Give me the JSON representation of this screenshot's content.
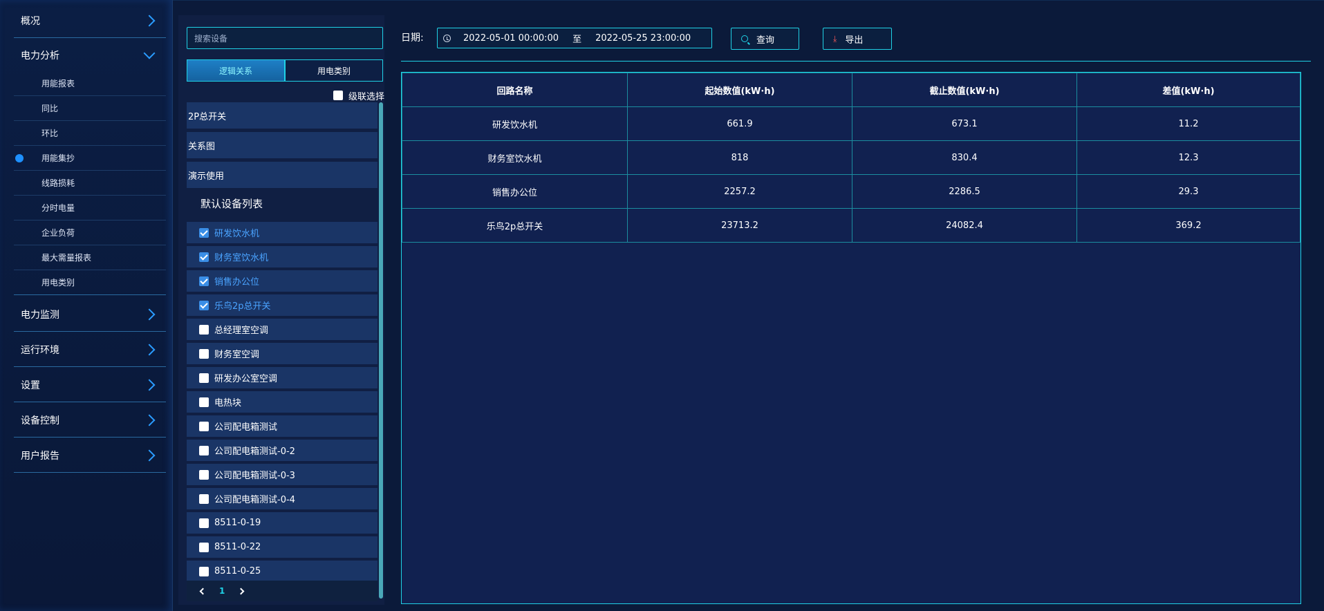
{
  "sidebar": {
    "overview": "概况",
    "power_analysis": "电力分析",
    "sub_items": [
      "用能报表",
      "同比",
      "环比",
      "用能集抄",
      "线路损耗",
      "分时电量",
      "企业负荷",
      "最大需量报表",
      "用电类别"
    ],
    "active_sub": "用能集抄",
    "groups": [
      "电力监测",
      "运行环境",
      "设置",
      "设备控制",
      "用户报告"
    ]
  },
  "device_panel": {
    "search_placeholder": "搜索设备",
    "tabs": [
      "逻辑关系",
      "用电类别"
    ],
    "active_tab": "逻辑关系",
    "cascade_label": "级联选择",
    "relations": [
      "2P总开关",
      "关系图",
      "演示使用"
    ],
    "device_list_title": "默认设备列表",
    "devices": [
      {
        "name": "研发饮水机",
        "checked": true
      },
      {
        "name": "财务室饮水机",
        "checked": true
      },
      {
        "name": "销售办公位",
        "checked": true
      },
      {
        "name": "乐鸟2p总开关",
        "checked": true
      },
      {
        "name": "总经理室空调",
        "checked": false
      },
      {
        "name": "财务室空调",
        "checked": false
      },
      {
        "name": "研发办公室空调",
        "checked": false
      },
      {
        "name": "电热块",
        "checked": false
      },
      {
        "name": "公司配电箱测试",
        "checked": false
      },
      {
        "name": "公司配电箱测试-0-2",
        "checked": false
      },
      {
        "name": "公司配电箱测试-0-3",
        "checked": false
      },
      {
        "name": "公司配电箱测试-0-4",
        "checked": false
      },
      {
        "name": "8511-0-19",
        "checked": false
      },
      {
        "name": "8511-0-22",
        "checked": false
      },
      {
        "name": "8511-0-25",
        "checked": false
      }
    ],
    "page": "1"
  },
  "toolbar": {
    "date_label": "日期:",
    "start": "2022-05-01 00:00:00",
    "to": "至",
    "end": "2022-05-25 23:00:00",
    "query": "查询",
    "export": "导出",
    "export_icon": "⤓"
  },
  "table": {
    "headers": [
      "回路名称",
      "起始数值(kW·h)",
      "截止数值(kW·h)",
      "差值(kW·h)"
    ],
    "rows": [
      [
        "研发饮水机",
        "661.9",
        "673.1",
        "11.2"
      ],
      [
        "财务室饮水机",
        "818",
        "830.4",
        "12.3"
      ],
      [
        "销售办公位",
        "2257.2",
        "2286.5",
        "29.3"
      ],
      [
        "乐鸟2p总开关",
        "23713.2",
        "24082.4",
        "369.2"
      ]
    ]
  },
  "colors": {
    "accent": "#1fd2e6",
    "active_blue": "#1e90ff"
  }
}
